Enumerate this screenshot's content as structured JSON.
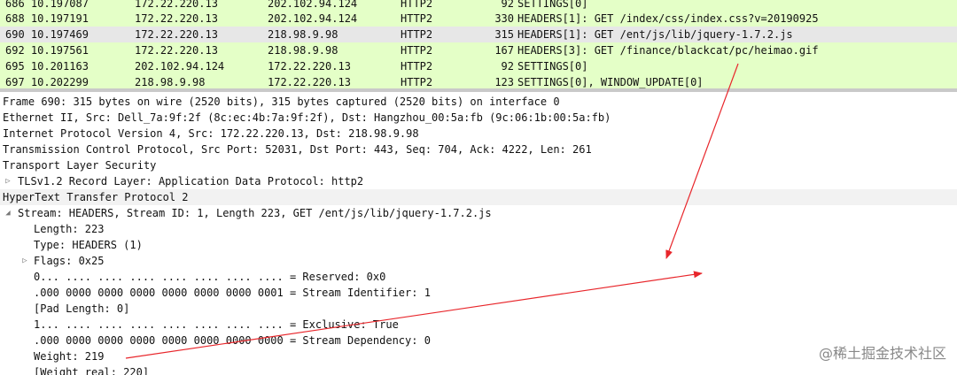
{
  "packets": [
    {
      "no_time": "686 10.197087",
      "source": "172.22.220.13",
      "destination": "202.102.94.124",
      "protocol": "HTTP2",
      "length": "92",
      "info": "SETTINGS[0]"
    },
    {
      "no_time": "688 10.197191",
      "source": "172.22.220.13",
      "destination": "202.102.94.124",
      "protocol": "HTTP2",
      "length": "330",
      "info": "HEADERS[1]: GET /index/css/index.css?v=20190925"
    },
    {
      "no_time": "690 10.197469",
      "source": "172.22.220.13",
      "destination": "218.98.9.98",
      "protocol": "HTTP2",
      "length": "315",
      "info": "HEADERS[1]: GET /ent/js/lib/jquery-1.7.2.js"
    },
    {
      "no_time": "692 10.197561",
      "source": "172.22.220.13",
      "destination": "218.98.9.98",
      "protocol": "HTTP2",
      "length": "167",
      "info": "HEADERS[3]: GET /finance/blackcat/pc/heimao.gif"
    },
    {
      "no_time": "695 10.201163",
      "source": "202.102.94.124",
      "destination": "172.22.220.13",
      "protocol": "HTTP2",
      "length": "92",
      "info": "SETTINGS[0]"
    },
    {
      "no_time": "697 10.202299",
      "source": "218.98.9.98",
      "destination": "172.22.220.13",
      "protocol": "HTTP2",
      "length": "123",
      "info": "SETTINGS[0], WINDOW_UPDATE[0]"
    }
  ],
  "details": [
    {
      "text": "Frame 690: 315 bytes on wire (2520 bits), 315 bytes captured (2520 bits) on interface 0"
    },
    {
      "text": "Ethernet II, Src: Dell_7a:9f:2f (8c:ec:4b:7a:9f:2f), Dst: Hangzhou_00:5a:fb (9c:06:1b:00:5a:fb)"
    },
    {
      "text": "Internet Protocol Version 4, Src: 172.22.220.13, Dst: 218.98.9.98"
    },
    {
      "text": "Transmission Control Protocol, Src Port: 52031, Dst Port: 443, Seq: 704, Ack: 4222, Len: 261"
    },
    {
      "text": "Transport Layer Security"
    },
    {
      "text": "TLSv1.2 Record Layer: Application Data Protocol: http2"
    },
    {
      "text": "HyperText Transfer Protocol 2"
    },
    {
      "text": "Stream: HEADERS, Stream ID: 1, Length 223, GET /ent/js/lib/jquery-1.7.2.js"
    },
    {
      "text": "Length: 223"
    },
    {
      "text": "Type: HEADERS (1)"
    },
    {
      "text": "Flags: 0x25"
    },
    {
      "text": "0... .... .... .... .... .... .... .... = Reserved: 0x0"
    },
    {
      "text": ".000 0000 0000 0000 0000 0000 0000 0001 = Stream Identifier: 1"
    },
    {
      "text": "[Pad Length: 0]"
    },
    {
      "text": "1... .... .... .... .... .... .... .... = Exclusive: True"
    },
    {
      "text": ".000 0000 0000 0000 0000 0000 0000 0000 = Stream Dependency: 0"
    },
    {
      "text": "Weight: 219"
    },
    {
      "text": "[Weight real: 220]"
    }
  ],
  "icons": {
    "collapsed": "triangle-right",
    "expanded": "triangle-down"
  },
  "watermark": "@稀土掘金技术社区",
  "colors": {
    "packet_bg": "#e4ffc7",
    "selected_bg": "#e7e7e7",
    "annotation_arrow": "#e8262b",
    "watermark": "#888888"
  }
}
